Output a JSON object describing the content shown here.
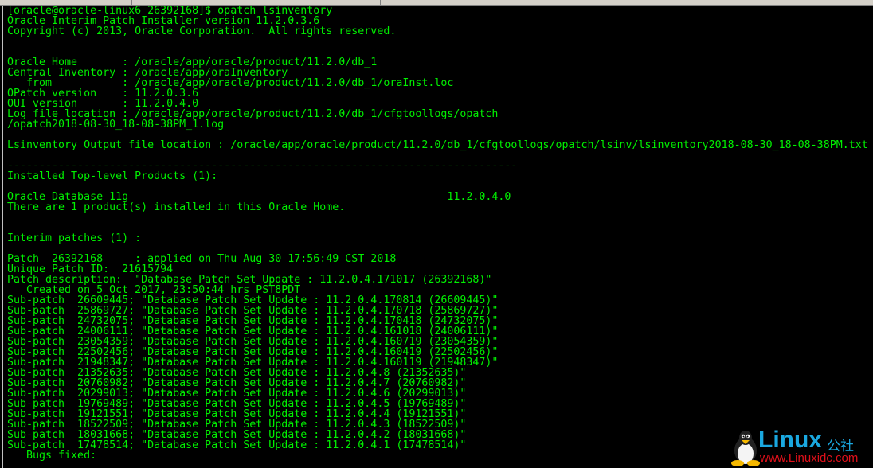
{
  "terminal": {
    "lines": [
      "[oracle@oracle-linux6 26392168]$ opatch lsinventory",
      "Oracle Interim Patch Installer version 11.2.0.3.6",
      "Copyright (c) 2013, Oracle Corporation.  All rights reserved.",
      "",
      "",
      "Oracle Home       : /oracle/app/oracle/product/11.2.0/db_1",
      "Central Inventory : /oracle/app/oraInventory",
      "   from           : /oracle/app/oracle/product/11.2.0/db_1/oraInst.loc",
      "OPatch version    : 11.2.0.3.6",
      "OUI version       : 11.2.0.4.0",
      "Log file location : /oracle/app/oracle/product/11.2.0/db_1/cfgtoollogs/opatch",
      "/opatch2018-08-30_18-08-38PM_1.log",
      "",
      "Lsinventory Output file location : /oracle/app/oracle/product/11.2.0/db_1/cfgtoollogs/opatch/lsinv/lsinventory2018-08-30_18-08-38PM.txt",
      "",
      "--------------------------------------------------------------------------------",
      "Installed Top-level Products (1):",
      "",
      "Oracle Database 11g                                                  11.2.0.4.0",
      "There are 1 product(s) installed in this Oracle Home.",
      "",
      "",
      "Interim patches (1) :",
      "",
      "Patch  26392168     : applied on Thu Aug 30 17:56:49 CST 2018",
      "Unique Patch ID:  21615794",
      "Patch description:  \"Database Patch Set Update : 11.2.0.4.171017 (26392168)\"",
      "   Created on 5 Oct 2017, 23:50:44 hrs PST8PDT",
      "Sub-patch  26609445; \"Database Patch Set Update : 11.2.0.4.170814 (26609445)\"",
      "Sub-patch  25869727; \"Database Patch Set Update : 11.2.0.4.170718 (25869727)\"",
      "Sub-patch  24732075; \"Database Patch Set Update : 11.2.0.4.170418 (24732075)\"",
      "Sub-patch  24006111; \"Database Patch Set Update : 11.2.0.4.161018 (24006111)\"",
      "Sub-patch  23054359; \"Database Patch Set Update : 11.2.0.4.160719 (23054359)\"",
      "Sub-patch  22502456; \"Database Patch Set Update : 11.2.0.4.160419 (22502456)\"",
      "Sub-patch  21948347; \"Database Patch Set Update : 11.2.0.4.160119 (21948347)\"",
      "Sub-patch  21352635; \"Database Patch Set Update : 11.2.0.4.8 (21352635)\"",
      "Sub-patch  20760982; \"Database Patch Set Update : 11.2.0.4.7 (20760982)\"",
      "Sub-patch  20299013; \"Database Patch Set Update : 11.2.0.4.6 (20299013)\"",
      "Sub-patch  19769489; \"Database Patch Set Update : 11.2.0.4.5 (19769489)\"",
      "Sub-patch  19121551; \"Database Patch Set Update : 11.2.0.4.4 (19121551)\"",
      "Sub-patch  18522509; \"Database Patch Set Update : 11.2.0.4.3 (18522509)\"",
      "Sub-patch  18031668; \"Database Patch Set Update : 11.2.0.4.2 (18031668)\"",
      "Sub-patch  17478514; \"Database Patch Set Update : 11.2.0.4.1 (17478514)\"",
      "   Bugs fixed:"
    ],
    "text_color": "#00f000",
    "background": "#000000"
  },
  "watermark": {
    "brand": "Linux",
    "brand_cn": "公社",
    "url": "www.Linuxidc.com"
  }
}
